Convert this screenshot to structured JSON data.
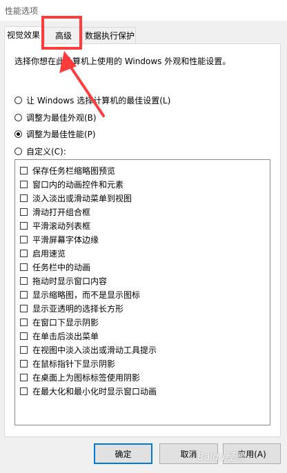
{
  "window": {
    "title": "性能选项"
  },
  "tabs": [
    {
      "label": "视觉效果"
    },
    {
      "label": "高级"
    },
    {
      "label": "数据执行保护"
    }
  ],
  "panel": {
    "instruction": "选择你想在此计算机上使用的 Windows 外观和性能设置。",
    "radios": [
      {
        "label": "让 Windows 选择计算机的最佳设置(L)",
        "checked": false
      },
      {
        "label": "调整为最佳外观(B)",
        "checked": false
      },
      {
        "label": "调整为最佳性能(P)",
        "checked": true
      },
      {
        "label": "自定义(C):",
        "checked": false
      }
    ],
    "options": [
      "保存任务栏缩略图预览",
      "窗口内的动画控件和元素",
      "淡入淡出或滑动菜单到视图",
      "滑动打开组合框",
      "平滑滚动列表框",
      "平滑屏幕字体边缘",
      "启用速览",
      "任务栏中的动画",
      "拖动时显示窗口内容",
      "显示缩略图，而不是显示图标",
      "显示亚透明的选择长方形",
      "在窗口下显示阴影",
      "在单击后淡出菜单",
      "在视图中淡入淡出或滑动工具提示",
      "在鼠标指针下显示阴影",
      "在桌面上为图标标签使用阴影",
      "在最大化和最小化时显示窗口动画"
    ]
  },
  "buttons": {
    "ok": "确定",
    "cancel": "取消",
    "apply": "应用(A)"
  },
  "annotation": {
    "color": "#ff3b3b"
  },
  "watermark": {
    "text": "Baidu经验"
  }
}
